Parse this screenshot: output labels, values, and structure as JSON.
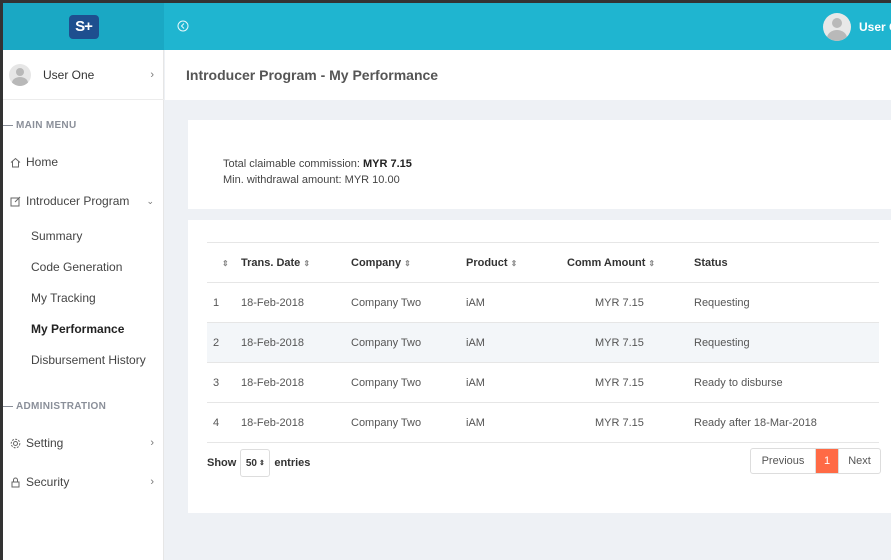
{
  "app": {
    "logo_text": "S+"
  },
  "topbar": {
    "user_name": "User One"
  },
  "sidebar": {
    "user_name": "User One",
    "main_menu_label": "MAIN MENU",
    "home": "Home",
    "introducer_program": "Introducer Program",
    "sub_items": [
      "Summary",
      "Code Generation",
      "My Tracking",
      "My Performance",
      "Disbursement History"
    ],
    "active_sub_item": "My Performance",
    "administration_label": "ADMINISTRATION",
    "setting": "Setting",
    "security": "Security"
  },
  "page": {
    "title": "Introducer Program - My Performance"
  },
  "summary": {
    "commission_label": "Total claimable commission: ",
    "commission_value": "MYR 7.15",
    "min_withdrawal": "Min. withdrawal amount: MYR 10.00"
  },
  "table": {
    "columns": [
      "",
      "Trans. Date",
      "Company",
      "Product",
      "Comm Amount",
      "Status"
    ],
    "rows": [
      [
        "1",
        "18-Feb-2018",
        "Company Two",
        "iAM",
        "MYR 7.15",
        "Requesting"
      ],
      [
        "2",
        "18-Feb-2018",
        "Company Two",
        "iAM",
        "MYR 7.15",
        "Requesting"
      ],
      [
        "3",
        "18-Feb-2018",
        "Company Two",
        "iAM",
        "MYR 7.15",
        "Ready to disburse"
      ],
      [
        "4",
        "18-Feb-2018",
        "Company Two",
        "iAM",
        "MYR 7.15",
        "Ready after 18-Mar-2018"
      ]
    ]
  },
  "length_menu": {
    "show": "Show",
    "value": "50",
    "entries": "entries"
  },
  "pagination": {
    "previous": "Previous",
    "current": "1",
    "next": "Next"
  },
  "colors": {
    "topbar": "#1fb5d0",
    "logo_bg": "#1e4f8f",
    "active_page": "#ff6a45",
    "page_bg": "#eef1f5"
  }
}
